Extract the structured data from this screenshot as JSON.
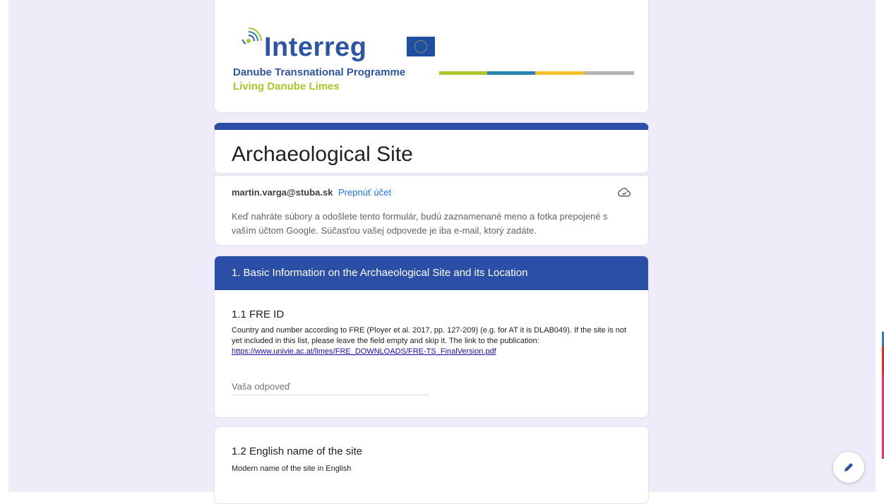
{
  "header": {
    "logo_word": "Interreg",
    "logo_subtitle_1": "Danube Transnational Programme",
    "logo_subtitle_2": "Living Danube Limes",
    "stripe_colors": [
      "#a8c82a",
      "#2b84b0",
      "#f2c22e",
      "#b4b4b4"
    ]
  },
  "form": {
    "title": "Archaeological Site"
  },
  "account": {
    "email": "martin.varga@stuba.sk",
    "switch_label": "Prepnúť účet",
    "note": "Keď nahráte súbory a odošlete tento formulár, budú zaznamenané meno a fotka prepojené s vaším účtom Google. Súčasťou vašej odpovede je iba e-mail, ktorý zadáte."
  },
  "section": {
    "title": "1. Basic Information on the Archaeological Site and its Location"
  },
  "questions": [
    {
      "title": "1.1 FRE ID",
      "description": "Country and number according to FRE (Ployer et al. 2017, pp. 127-209) (e.g. for AT it is DLAB049). If the site is not yet included in this list, please leave the field empty and skip it. The link to the publication:",
      "link": "https://www.univie.ac.at/limes/FRE_DOWNLOADS/FRE-TS_FinalVersion.pdf",
      "placeholder": "Vaša odpoveď"
    },
    {
      "title": "1.2 English name of the site",
      "description": "Modern name of the site in English"
    }
  ],
  "colors": {
    "accent": "#2b4fa6",
    "page_background": "#f0ebf8",
    "link": "#1a73e8"
  }
}
